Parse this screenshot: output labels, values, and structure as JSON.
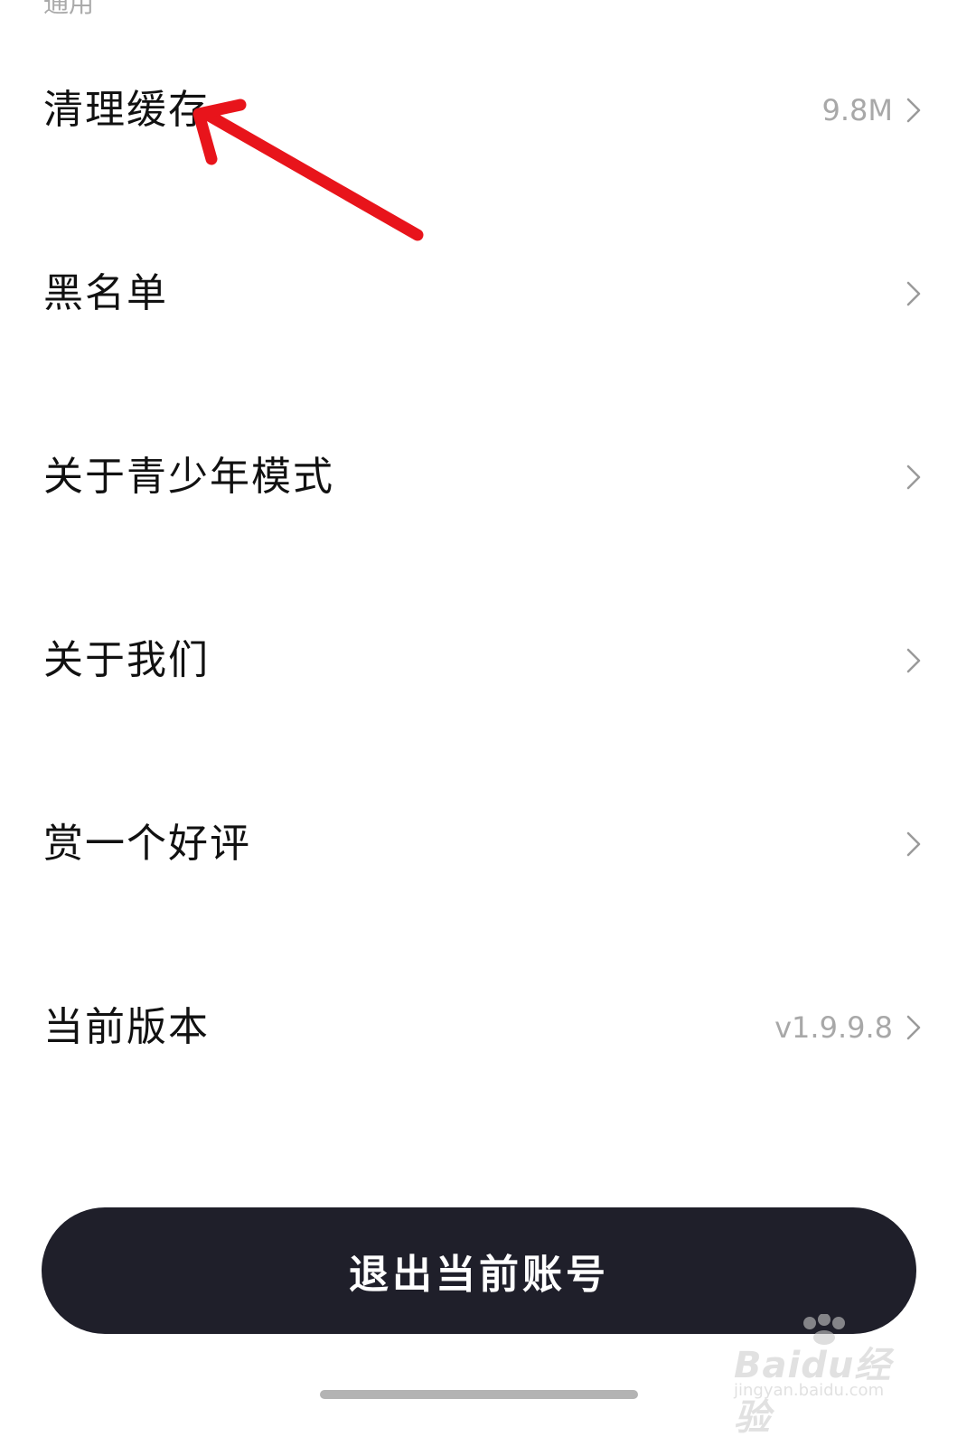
{
  "section": {
    "header": "通用"
  },
  "rows": [
    {
      "label": "清理缓存",
      "value": "9.8M"
    },
    {
      "label": "黑名单",
      "value": ""
    },
    {
      "label": "关于青少年模式",
      "value": ""
    },
    {
      "label": "关于我们",
      "value": ""
    },
    {
      "label": "赏一个好评",
      "value": ""
    },
    {
      "label": "当前版本",
      "value": "v1.9.9.8"
    }
  ],
  "logout": {
    "label": "退出当前账号"
  },
  "watermark": {
    "brand": "Baidu经验",
    "url": "jingyan.baidu.com"
  },
  "icons": {
    "row_chevron": "chevron-right-icon",
    "annotation": "red-arrow-icon"
  },
  "colors": {
    "button_bg": "#1f1f2a",
    "annotation": "#e8141b",
    "secondary_text": "#a8a8a8"
  }
}
